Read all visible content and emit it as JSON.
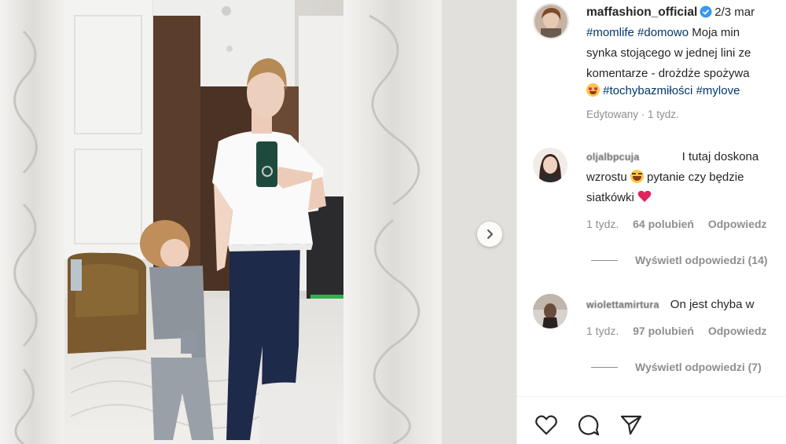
{
  "post": {
    "owner": "maffashion_official",
    "date_fragment": "2/3 mar",
    "caption_lines": [
      [
        "#momlife",
        "#domowo",
        "Moja min"
      ],
      "synka stojącego w jednej lini ze",
      "komentarze - drożdże spożywa",
      [
        "#tochybazmiłości",
        "#mylove"
      ]
    ],
    "edited": "Edytowany · 1 tydz."
  },
  "comments": [
    {
      "username": "oljalbpcuja",
      "lines": [
        "I tutaj doskona",
        "wzrostu",
        "pytanie czy będzie",
        "siatkówki"
      ],
      "age": "1 tydz.",
      "likes": "64 polubień",
      "reply": "Odpowiedz",
      "view_replies": "Wyświetl odpowiedzi (14)"
    },
    {
      "username": "wiolettamirtura",
      "text": "On jest chyba w",
      "age": "1 tydz.",
      "likes": "97 polubień",
      "reply": "Odpowiedz",
      "view_replies": "Wyświetl odpowiedzi (7)"
    }
  ],
  "icons": {
    "next": "chevron-right-icon",
    "verified": "verified-badge-icon",
    "like": "heart-outline-icon",
    "comment": "comment-bubble-icon",
    "share": "paper-plane-icon"
  },
  "colors": {
    "hashtag": "#00376b",
    "verified": "#3897f0",
    "muted": "#8e8e8e",
    "heart_emoji": "#e0245e"
  }
}
